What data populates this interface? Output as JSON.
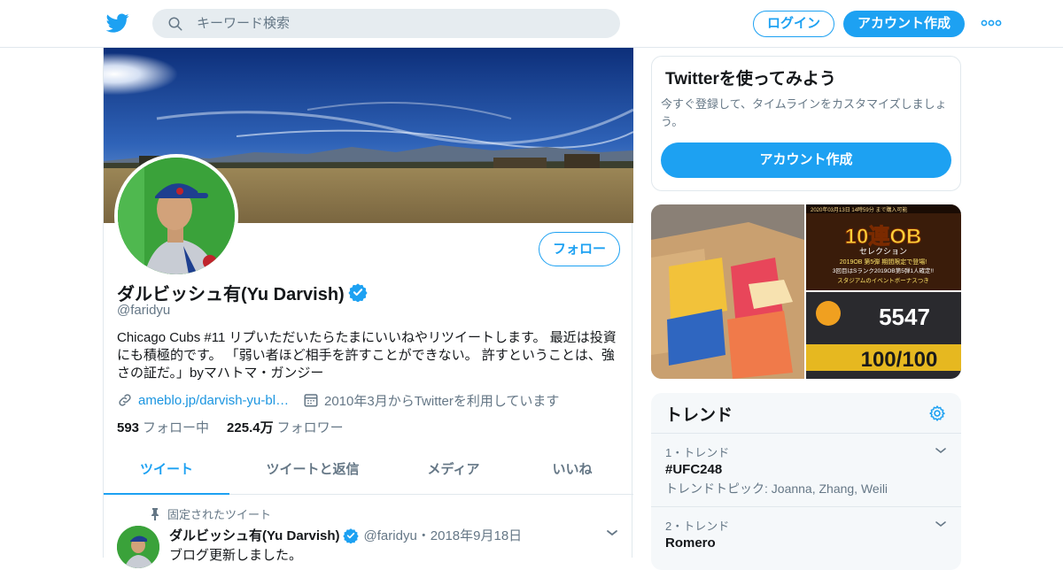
{
  "topbar": {
    "search_placeholder": "キーワード検索",
    "login_label": "ログイン",
    "signup_label": "アカウント作成"
  },
  "profile": {
    "name": "ダルビッシュ有(Yu Darvish)",
    "handle": "@faridyu",
    "follow_label": "フォロー",
    "bio": "Chicago Cubs #11 リプいただいたらたまにいいねやリツイートします。 最近は投資にも積極的です。 「弱い者ほど相手を許すことができない。 許すということは、強さの証だ。」byマハトマ・ガンジー",
    "website": "ameblo.jp/darvish-yu-blo…",
    "joined": "2010年3月からTwitterを利用しています",
    "following_count": "593",
    "following_label": "フォロー中",
    "followers_count": "225.4万",
    "followers_label": "フォロワー"
  },
  "tabs": [
    {
      "label": "ツイート",
      "active": true
    },
    {
      "label": "ツイートと返信",
      "active": false
    },
    {
      "label": "メディア",
      "active": false
    },
    {
      "label": "いいね",
      "active": false
    }
  ],
  "pinned_tweet": {
    "pinned_label": "固定されたツイート",
    "author_name": "ダルビッシュ有(Yu Darvish)",
    "author_meta": "@faridyu・2018年9月18日",
    "text": "ブログ更新しました。"
  },
  "signup_card": {
    "title": "Twitterを使ってみよう",
    "description": "今すぐ登録して、タイムラインをカスタマイズしましょう。",
    "cta_label": "アカウント作成"
  },
  "media": {
    "banner_top_text": "2020年03月13日 14時59分 まで購入可能",
    "banner_title": "10連OB",
    "banner_subtitle": "セレクション",
    "banner_line1": "2019OB 第5弾 期間限定で登場!",
    "banner_line2": "3回目はSランク2019OB第5弾1人確定!!",
    "banner_line3": "スタジアムのイベントボーナスつき",
    "game_number": "5547",
    "game_progress": "100/100"
  },
  "trends": {
    "title": "トレンド",
    "items": [
      {
        "rank": "1・トレンド",
        "name": "#UFC248",
        "sub": "トレンドトピック: Joanna, Zhang, Weili"
      },
      {
        "rank": "2・トレンド",
        "name": "Romero",
        "sub": ""
      }
    ]
  },
  "colors": {
    "accent": "#1da1f2",
    "text_secondary": "#657786",
    "border": "#e1e8ed"
  }
}
